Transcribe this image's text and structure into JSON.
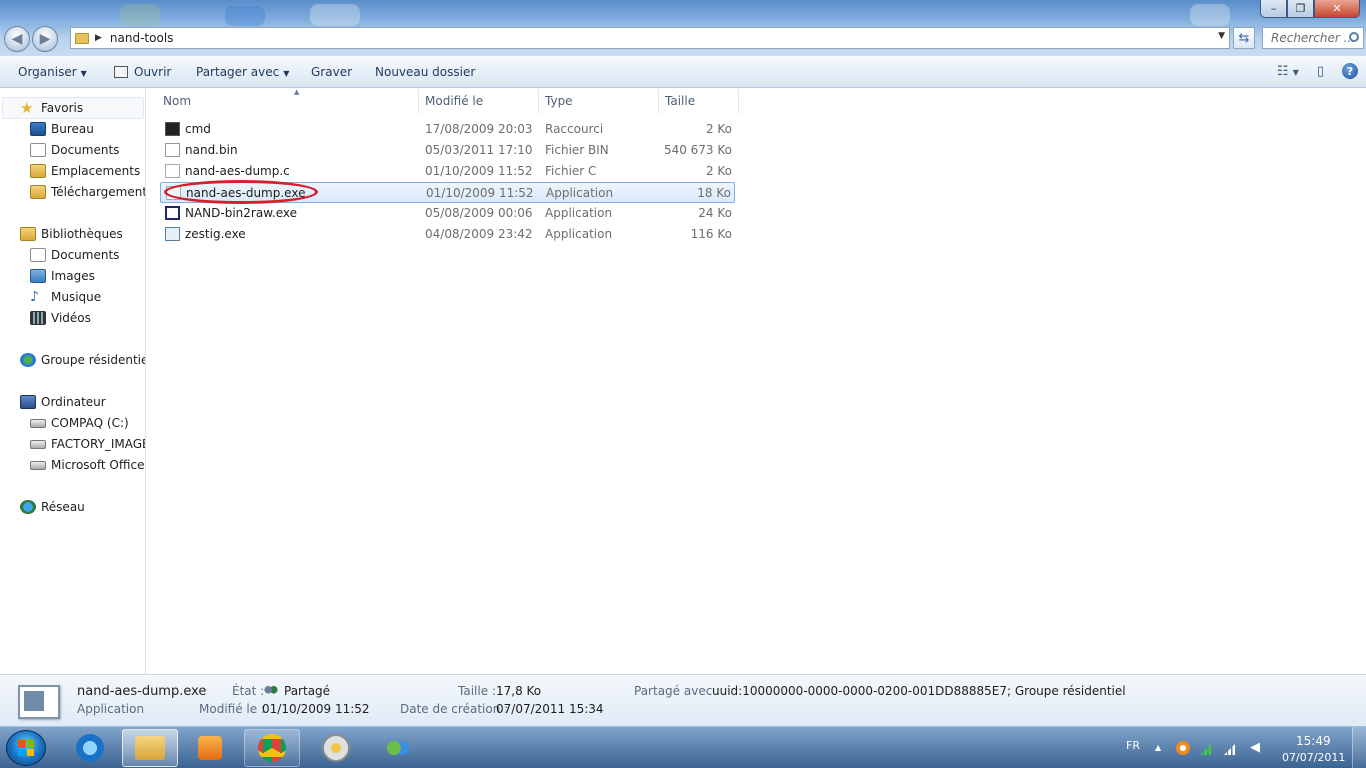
{
  "window": {
    "controls": {
      "minimize": "–",
      "maximize": "❐",
      "close": "✕"
    }
  },
  "address_bar": {
    "path": "nand-tools",
    "search_placeholder": "Rechercher ..."
  },
  "command_bar": {
    "organize": "Organiser",
    "open": "Ouvrir",
    "share": "Partager avec",
    "burn": "Graver",
    "new_folder": "Nouveau dossier"
  },
  "nav_pane": {
    "favorites_label": "Favoris",
    "favorites": [
      "Bureau",
      "Documents",
      "Emplacements ré",
      "Téléchargements"
    ],
    "libraries_label": "Bibliothèques",
    "libraries": [
      "Documents",
      "Images",
      "Musique",
      "Vidéos"
    ],
    "homegroup": "Groupe résidentiel",
    "computer_label": "Ordinateur",
    "drives": [
      "COMPAQ (C:)",
      "FACTORY_IMAGE",
      "Microsoft Office D"
    ],
    "network": "Réseau"
  },
  "file_list": {
    "columns": {
      "name": "Nom",
      "modified": "Modifié le",
      "type": "Type",
      "size": "Taille"
    },
    "rows": [
      {
        "name": "cmd",
        "modified": "17/08/2009 20:03",
        "type": "Raccourci",
        "size": "2 Ko",
        "icon": "cmd-shortcut-icon"
      },
      {
        "name": "nand.bin",
        "modified": "05/03/2011 17:10",
        "type": "Fichier BIN",
        "size": "540 673 Ko",
        "icon": "bin-file-icon"
      },
      {
        "name": "nand-aes-dump.c",
        "modified": "01/10/2009 11:52",
        "type": "Fichier C",
        "size": "2 Ko",
        "icon": "c-file-icon"
      },
      {
        "name": "nand-aes-dump.exe",
        "modified": "01/10/2009 11:52",
        "type": "Application",
        "size": "18 Ko",
        "icon": "exe-file-icon",
        "selected": true
      },
      {
        "name": "NAND-bin2raw.exe",
        "modified": "05/08/2009 00:06",
        "type": "Application",
        "size": "24 Ko",
        "icon": "exe-file-icon"
      },
      {
        "name": "zestig.exe",
        "modified": "04/08/2009 23:42",
        "type": "Application",
        "size": "116 Ko",
        "icon": "exe-file-icon"
      }
    ]
  },
  "details_pane": {
    "name": "nand-aes-dump.exe",
    "kind": "Application",
    "state_label": "État :",
    "state_value": "Partagé",
    "modified_label": "Modifié le :",
    "modified_value": "01/10/2009 11:52",
    "size_label": "Taille :",
    "size_value": "17,8 Ko",
    "created_label": "Date de création :",
    "created_value": "07/07/2011 15:34",
    "shared_label": "Partagé avec :",
    "shared_value": "uuid:10000000-0000-0000-0200-001DD88885E7; Groupe résidentiel"
  },
  "taskbar": {
    "language": "FR",
    "time": "15:49",
    "date": "07/07/2011"
  },
  "colors": {
    "annotation_red": "#d4202a",
    "selection_border": "#84acdd"
  }
}
